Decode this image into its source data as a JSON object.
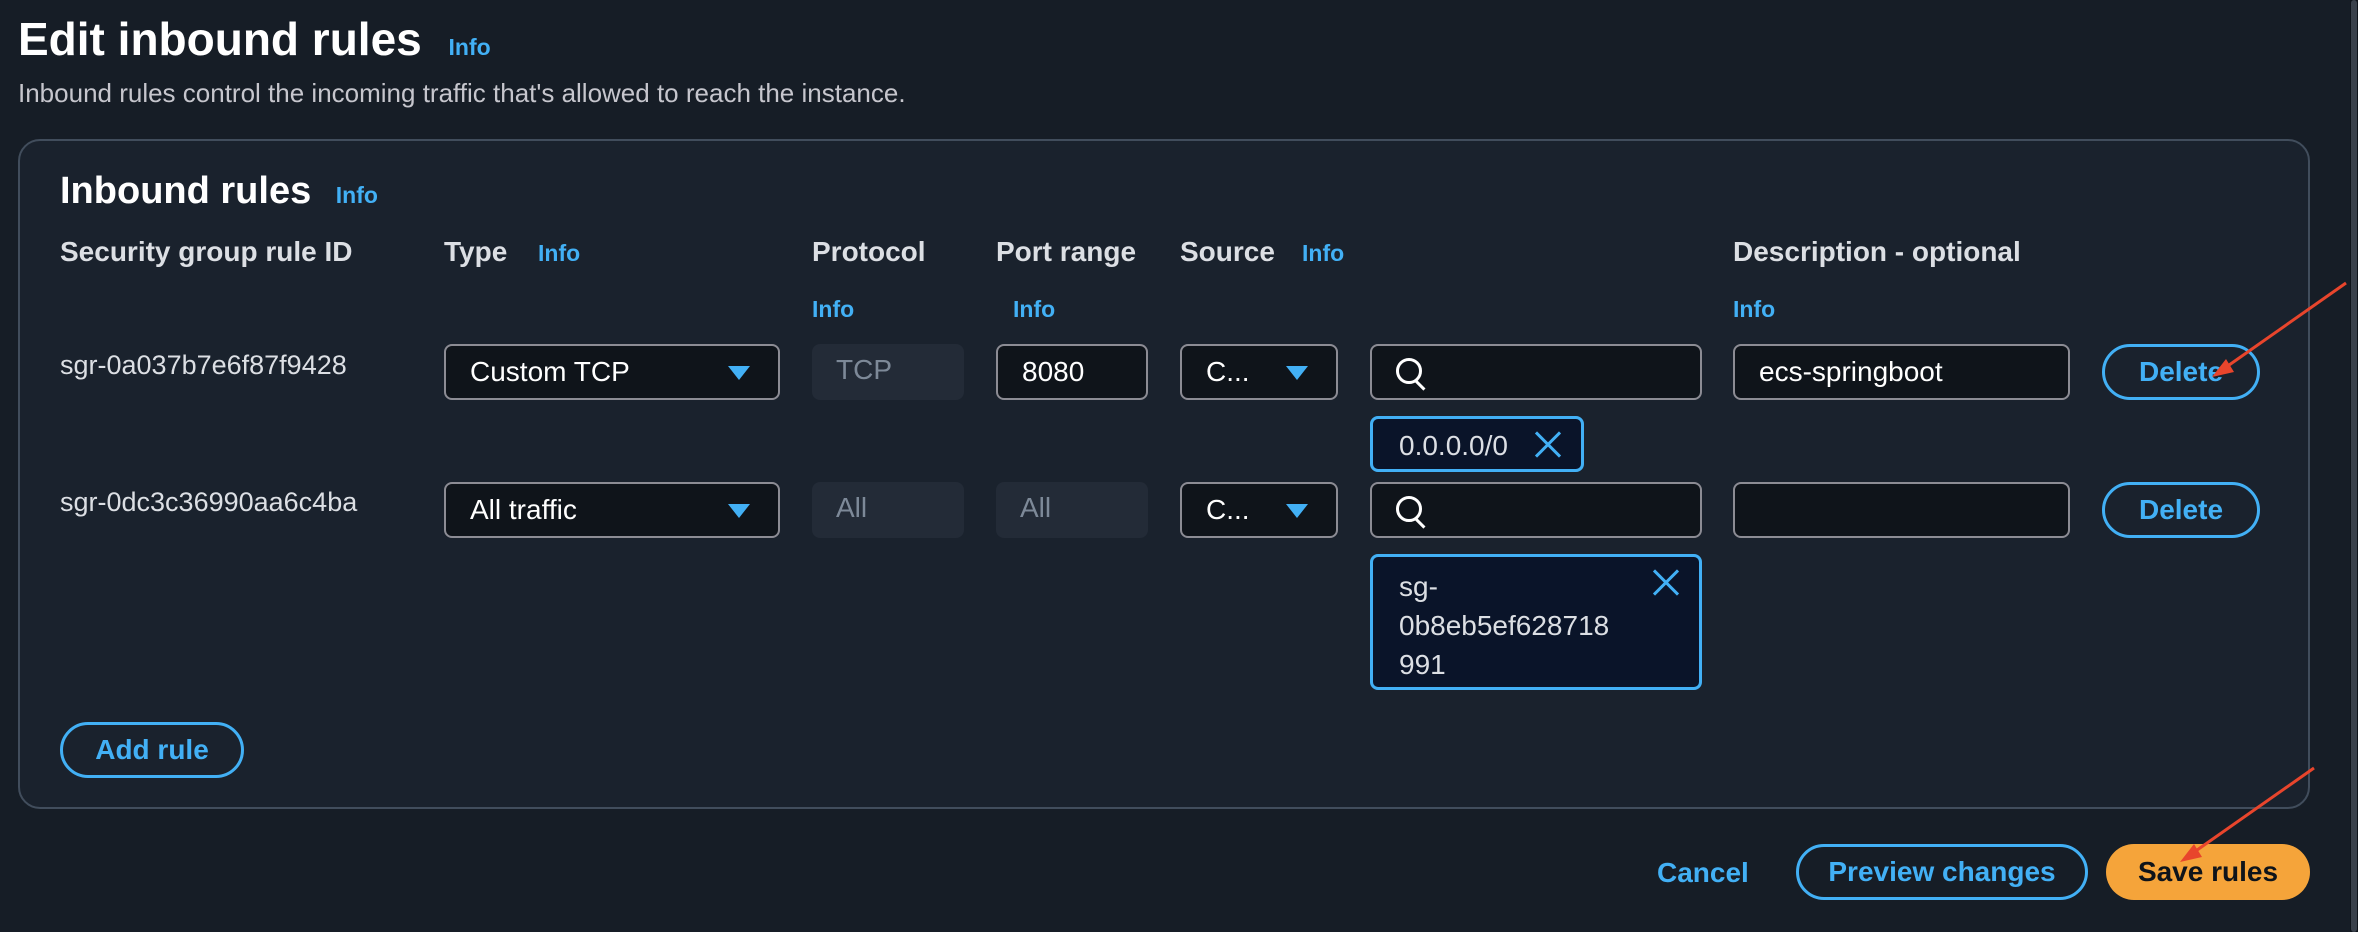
{
  "page": {
    "title": "Edit inbound rules",
    "title_info": "Info",
    "subtitle": "Inbound rules control the incoming traffic that's allowed to reach the instance."
  },
  "panel": {
    "title": "Inbound rules",
    "title_info": "Info"
  },
  "columns": {
    "rule_id": "Security group rule ID",
    "type": "Type",
    "type_info": "Info",
    "protocol": "Protocol",
    "protocol_info": "Info",
    "port_range": "Port range",
    "port_info": "Info",
    "source": "Source",
    "source_info": "Info",
    "description": "Description - optional",
    "description_info": "Info"
  },
  "rules": [
    {
      "id": "sgr-0a037b7e6f87f9428",
      "type": "Custom TCP",
      "protocol": "TCP",
      "port_range": "8080",
      "source_type": "C...",
      "source_search": "",
      "source_tokens": [
        "0.0.0.0/0"
      ],
      "description": "ecs-springboot",
      "delete_label": "Delete"
    },
    {
      "id": "sgr-0dc3c36990aa6c4ba",
      "type": "All traffic",
      "protocol": "All",
      "port_range": "All",
      "source_type": "C...",
      "source_search": "",
      "source_token_lines": [
        "sg-",
        "0b8eb5ef628718",
        "991"
      ],
      "description": "",
      "delete_label": "Delete"
    }
  ],
  "actions": {
    "add_rule": "Add rule",
    "cancel": "Cancel",
    "preview": "Preview changes",
    "save": "Save rules"
  },
  "colors": {
    "background": "#161d26",
    "accent": "#42b0f5",
    "primary": "#f5a43a",
    "annotation_arrow": "#e8452c"
  },
  "icons": [
    "search-icon",
    "caret-down-icon",
    "close-icon",
    "annotation-arrow"
  ]
}
